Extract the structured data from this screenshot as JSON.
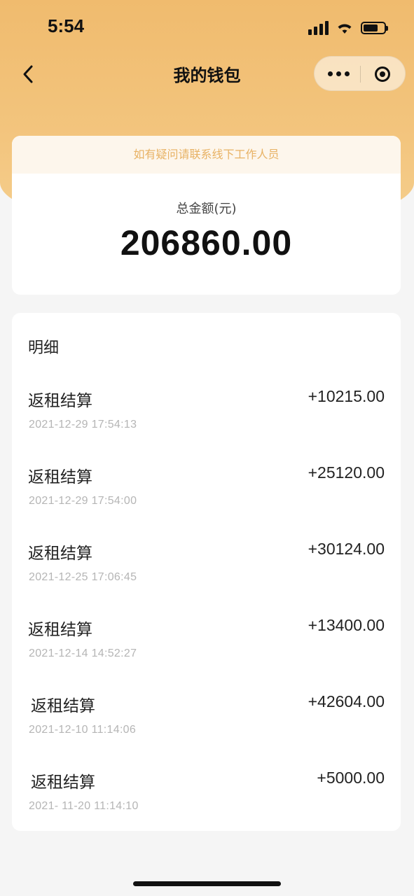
{
  "status_bar": {
    "time": "5:54",
    "battery_level": 0.7
  },
  "nav": {
    "title": "我的钱包",
    "back_icon": "chevron-left-icon",
    "more_icon": "more-dots-icon",
    "close_icon": "target-circle-icon"
  },
  "wallet": {
    "notice": "如有疑问请联系线下工作人员",
    "total_label": "总金额(元)",
    "total_amount": "206860.00"
  },
  "details": {
    "title": "明细",
    "items": [
      {
        "name": "返租结算",
        "amount": "+10215.00",
        "time": "2021-12-29  17:54:13"
      },
      {
        "name": "返租结算",
        "amount": "+25120.00",
        "time": "2021-12-29  17:54:00"
      },
      {
        "name": "返租结算",
        "amount": "+30124.00",
        "time": "2021-12-25  17:06:45"
      },
      {
        "name": "返租结算",
        "amount": "+13400.00",
        "time": "2021-12-14   14:52:27"
      },
      {
        "name": "返租结算",
        "amount": "+42604.00",
        "time": "2021-12-10   11:14:06"
      },
      {
        "name": "返租结算",
        "amount": "+5000.00",
        "time": "2021- 11-20  11:14:10"
      }
    ]
  },
  "colors": {
    "header_gradient_start": "#f0bb6e",
    "header_gradient_end": "#f5cf8e",
    "notice_text": "#e8b264",
    "notice_bg": "#fdf6ec"
  }
}
